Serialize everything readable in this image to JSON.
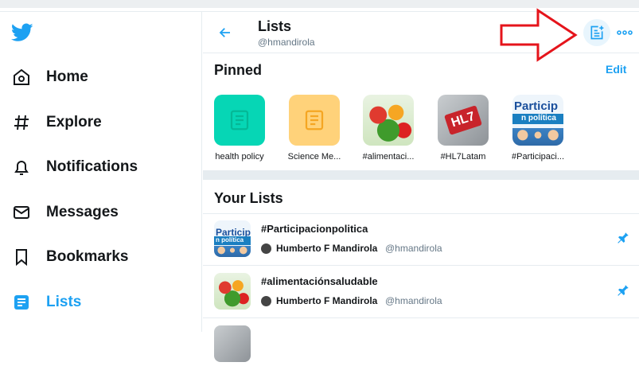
{
  "sidebar": {
    "logo": "twitter-bird-icon",
    "items": [
      {
        "label": "Home",
        "icon": "home-icon"
      },
      {
        "label": "Explore",
        "icon": "hashtag-icon"
      },
      {
        "label": "Notifications",
        "icon": "bell-icon"
      },
      {
        "label": "Messages",
        "icon": "envelope-icon"
      },
      {
        "label": "Bookmarks",
        "icon": "bookmark-icon"
      },
      {
        "label": "Lists",
        "icon": "lists-icon",
        "active": true
      }
    ]
  },
  "header": {
    "title": "Lists",
    "handle": "@hmandirola",
    "back_icon": "back-arrow-icon",
    "new_list_icon": "new-list-icon",
    "more_icon": "more-icon"
  },
  "pinned": {
    "title": "Pinned",
    "edit_label": "Edit",
    "items": [
      {
        "label": "health policy"
      },
      {
        "label": "Science Me..."
      },
      {
        "label": "#alimentaci..."
      },
      {
        "label": "#HL7Latam",
        "thumb_text": "HL7"
      },
      {
        "label": "#Participaci...",
        "thumb_text": "Particip",
        "thumb_band": "n política"
      }
    ]
  },
  "your_lists": {
    "title": "Your Lists",
    "items": [
      {
        "name": "#Participacionpolitica",
        "owner": "Humberto F Mandirola",
        "handle": "@hmandirola",
        "thumb_text": "Particip",
        "thumb_band": "n política"
      },
      {
        "name": "#alimentaciónsaludable",
        "owner": "Humberto F Mandirola",
        "handle": "@hmandirola"
      }
    ]
  },
  "colors": {
    "accent": "#1da1f2",
    "annotation_arrow": "#e5141b"
  }
}
